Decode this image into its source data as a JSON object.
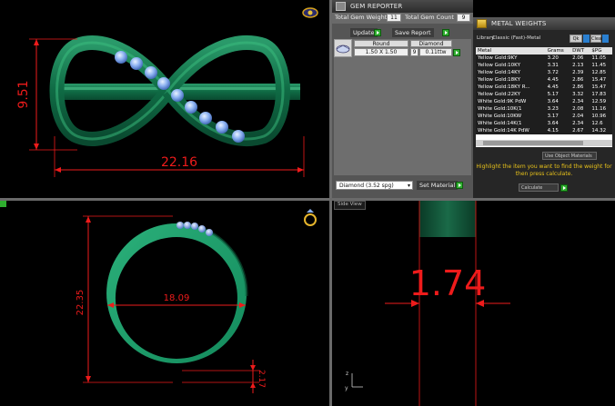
{
  "top_left_view": {
    "dims": {
      "height": "9.51",
      "width": "22.16"
    }
  },
  "bottom_left_view": {
    "dims": {
      "outer_height": "22.35",
      "inner_width": "18.09",
      "bottom_thickness": "2.17"
    }
  },
  "bottom_right_view": {
    "title": "Side View",
    "dims": {
      "thickness": "1.74"
    },
    "axis": {
      "y": "y",
      "z": "z"
    }
  },
  "gem_reporter": {
    "title": "GEM REPORTER",
    "total_weight_label": "Total Gem Weight",
    "total_weight_value": "11",
    "total_count_label": "Total Gem Count",
    "total_count_value": "9",
    "update_label": "Update",
    "save_report_label": "Save Report",
    "columns": [
      "Round",
      "Diamond"
    ],
    "row": {
      "size": "1.50 X 1.50",
      "count": "9",
      "weight": "0.11ttw"
    },
    "material_value": "Diamond      (3.52 spg)",
    "set_material_label": "Set Material"
  },
  "metal_weights": {
    "title": "METAL WEIGHTS",
    "library_label": "Library:",
    "library_value": "Classic (Fast)-Metal",
    "units_value": "Qk",
    "toggle_value": "Clear",
    "columns": [
      "Metal",
      "Grams",
      "DWT",
      "$PG"
    ],
    "rows": [
      [
        "Yellow Gold:9KY",
        "3.20",
        "2.06",
        "11.05"
      ],
      [
        "Yellow Gold:10KY",
        "3.31",
        "2.13",
        "11.45"
      ],
      [
        "Yellow Gold:14KY",
        "3.72",
        "2.39",
        "12.85"
      ],
      [
        "Yellow Gold:18KY",
        "4.45",
        "2.86",
        "15.47"
      ],
      [
        "Yellow Gold:18KY R...",
        "4.45",
        "2.86",
        "15.47"
      ],
      [
        "Yellow Gold:22KY",
        "5.17",
        "3.32",
        "17.83"
      ],
      [
        "White Gold:9K PdW",
        "3.64",
        "2.34",
        "12.59"
      ],
      [
        "White Gold:10K(1",
        "3.23",
        "2.08",
        "11.16"
      ],
      [
        "White Gold:10KW",
        "3.17",
        "2.04",
        "10.96"
      ],
      [
        "White Gold:14K(1",
        "3.64",
        "2.34",
        "12.6"
      ],
      [
        "White Gold:14K PdW",
        "4.15",
        "2.67",
        "14.32"
      ]
    ],
    "use_object_label": "Use Object Materials",
    "hint": "Highlight the item you want to find the weight for then press calculate.",
    "calculate_label": "Calculate"
  }
}
